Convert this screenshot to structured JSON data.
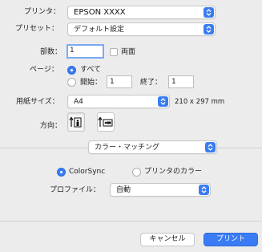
{
  "printer": {
    "label": "プリンタ：",
    "value": "EPSON XXXX"
  },
  "preset": {
    "label": "プリセット：",
    "value": "デフォルト設定"
  },
  "copies": {
    "label": "部数：",
    "value": "1",
    "duplex_label": "両面"
  },
  "pages": {
    "label": "ページ：",
    "all_label": "すべて",
    "from_label": "開始：",
    "from_value": "1",
    "to_label": "終了：",
    "to_value": "1",
    "selected": "all"
  },
  "paper": {
    "label": "用紙サイズ：",
    "value": "A4",
    "dimensions": "210 x 297 mm"
  },
  "orientation": {
    "label": "方向：",
    "selected": "portrait"
  },
  "section": {
    "value": "カラー・マッチング"
  },
  "color_matching": {
    "colorsync_label": "ColorSync",
    "printer_color_label": "プリンタのカラー",
    "selected": "colorsync",
    "profile_label": "プロファイル：",
    "profile_value": "自動"
  },
  "buttons": {
    "cancel": "キャンセル",
    "print": "プリント"
  },
  "colors": {
    "accent": "#3a7cf3",
    "background": "#ececec"
  }
}
